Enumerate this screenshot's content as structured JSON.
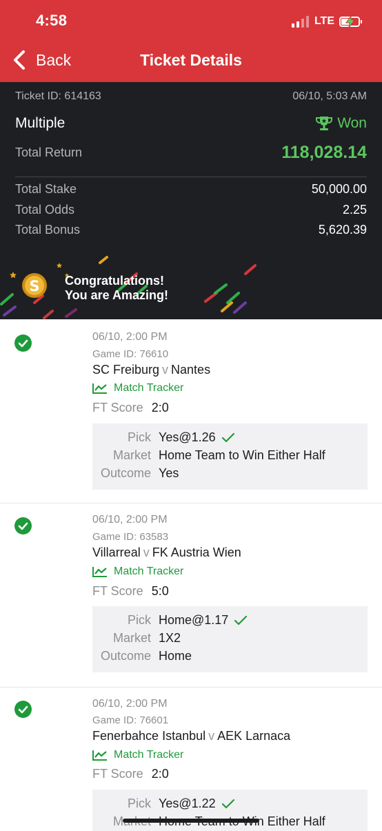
{
  "status_bar": {
    "time": "4:58",
    "network": "LTE"
  },
  "nav": {
    "back_label": "Back",
    "title": "Ticket Details"
  },
  "ticket": {
    "id_label": "Ticket ID: 614163",
    "datetime": "06/10, 5:03 AM",
    "type": "Multiple",
    "status": "Won",
    "total_return_label": "Total Return",
    "total_return": "118,028.14",
    "rows": [
      {
        "label": "Total Stake",
        "value": "50,000.00"
      },
      {
        "label": "Total Odds",
        "value": "2.25"
      },
      {
        "label": "Total Bonus",
        "value": "5,620.39"
      }
    ],
    "banner_line1": "Congratulations!",
    "banner_line2": "You are Amazing!"
  },
  "labels": {
    "match_tracker": "Match Tracker",
    "ft_score": "FT Score",
    "pick": "Pick",
    "market": "Market",
    "outcome": "Outcome",
    "vs": "v"
  },
  "matches": [
    {
      "time": "06/10, 2:00 PM",
      "game_id": "Game ID: 76610",
      "home": "SC Freiburg",
      "away": "Nantes",
      "score": "2:0",
      "pick": "Yes@1.26",
      "market": "Home Team to Win Either Half",
      "outcome": "Yes"
    },
    {
      "time": "06/10, 2:00 PM",
      "game_id": "Game ID: 63583",
      "home": "Villarreal",
      "away": "FK Austria Wien",
      "score": "5:0",
      "pick": "Home@1.17",
      "market": "1X2",
      "outcome": "Home"
    },
    {
      "time": "06/10, 2:00 PM",
      "game_id": "Game ID: 76601",
      "home": "Fenerbahce Istanbul",
      "away": "AEK Larnaca",
      "score": "2:0",
      "pick": "Yes@1.22",
      "market": "Home Team to Win Either Half",
      "outcome": ""
    }
  ],
  "colors": {
    "header_red": "#d8363a",
    "panel_dark": "#1e1f23",
    "win_green": "#5cc760",
    "check_green": "#1e9a3a"
  }
}
